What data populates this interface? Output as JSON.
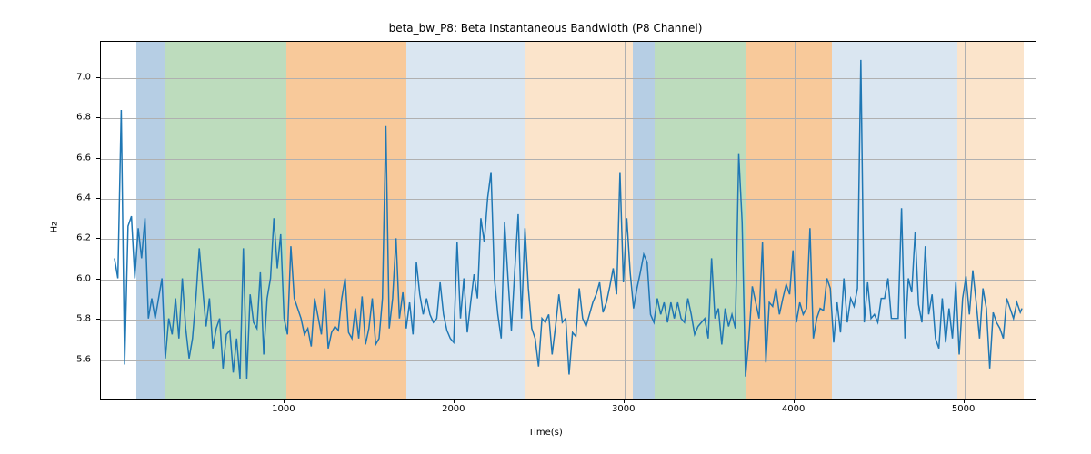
{
  "chart_data": {
    "type": "line",
    "title": "beta_bw_P8: Beta Instantaneous Bandwidth (P8 Channel)",
    "xlabel": "Time(s)",
    "ylabel": "Hz",
    "xlim": [
      -80,
      5430
    ],
    "ylim": [
      5.4,
      7.18
    ],
    "xticks": [
      1000,
      2000,
      3000,
      4000,
      5000
    ],
    "yticks": [
      5.6,
      5.8,
      6.0,
      6.2,
      6.4,
      6.6,
      6.8,
      7.0
    ],
    "bands": [
      {
        "x0": 130,
        "x1": 300,
        "color": "#b6cee4"
      },
      {
        "x0": 300,
        "x1": 1010,
        "color": "#bddcbd"
      },
      {
        "x0": 1010,
        "x1": 1720,
        "color": "#f8c99a"
      },
      {
        "x0": 1720,
        "x1": 2420,
        "color": "#dae6f1"
      },
      {
        "x0": 2420,
        "x1": 3050,
        "color": "#fbe4cb"
      },
      {
        "x0": 3050,
        "x1": 3180,
        "color": "#b6cee4"
      },
      {
        "x0": 3180,
        "x1": 3720,
        "color": "#bddcbd"
      },
      {
        "x0": 3720,
        "x1": 4220,
        "color": "#f8c99a"
      },
      {
        "x0": 4220,
        "x1": 4960,
        "color": "#dae6f1"
      },
      {
        "x0": 4960,
        "x1": 5350,
        "color": "#fbe4cb"
      }
    ],
    "x": [
      0,
      20,
      40,
      60,
      80,
      100,
      120,
      140,
      160,
      180,
      200,
      220,
      240,
      260,
      280,
      300,
      320,
      340,
      360,
      380,
      400,
      420,
      440,
      460,
      480,
      500,
      520,
      540,
      560,
      580,
      600,
      620,
      640,
      660,
      680,
      700,
      720,
      740,
      760,
      780,
      800,
      820,
      840,
      860,
      880,
      900,
      920,
      940,
      960,
      980,
      1000,
      1020,
      1040,
      1060,
      1080,
      1100,
      1120,
      1140,
      1160,
      1180,
      1200,
      1220,
      1240,
      1260,
      1280,
      1300,
      1320,
      1340,
      1360,
      1380,
      1400,
      1420,
      1440,
      1460,
      1480,
      1500,
      1520,
      1540,
      1560,
      1580,
      1600,
      1620,
      1640,
      1660,
      1680,
      1700,
      1720,
      1740,
      1760,
      1780,
      1800,
      1820,
      1840,
      1860,
      1880,
      1900,
      1920,
      1940,
      1960,
      1980,
      2000,
      2020,
      2040,
      2060,
      2080,
      2100,
      2120,
      2140,
      2160,
      2180,
      2200,
      2220,
      2240,
      2260,
      2280,
      2300,
      2320,
      2340,
      2360,
      2380,
      2400,
      2420,
      2440,
      2460,
      2480,
      2500,
      2520,
      2540,
      2560,
      2580,
      2600,
      2620,
      2640,
      2660,
      2680,
      2700,
      2720,
      2740,
      2760,
      2780,
      2800,
      2820,
      2840,
      2860,
      2880,
      2900,
      2920,
      2940,
      2960,
      2980,
      3000,
      3020,
      3040,
      3060,
      3080,
      3100,
      3120,
      3140,
      3160,
      3180,
      3200,
      3220,
      3240,
      3260,
      3280,
      3300,
      3320,
      3340,
      3360,
      3380,
      3400,
      3420,
      3440,
      3460,
      3480,
      3500,
      3520,
      3540,
      3560,
      3580,
      3600,
      3620,
      3640,
      3660,
      3680,
      3700,
      3720,
      3740,
      3760,
      3780,
      3800,
      3820,
      3840,
      3860,
      3880,
      3900,
      3920,
      3940,
      3960,
      3980,
      4000,
      4020,
      4040,
      4060,
      4080,
      4100,
      4120,
      4140,
      4160,
      4180,
      4200,
      4220,
      4240,
      4260,
      4280,
      4300,
      4320,
      4340,
      4360,
      4380,
      4400,
      4420,
      4440,
      4460,
      4480,
      4500,
      4520,
      4540,
      4560,
      4580,
      4600,
      4620,
      4640,
      4660,
      4680,
      4700,
      4720,
      4740,
      4760,
      4780,
      4800,
      4820,
      4840,
      4860,
      4880,
      4900,
      4920,
      4940,
      4960,
      4980,
      5000,
      5020,
      5040,
      5060,
      5080,
      5100,
      5120,
      5140,
      5160,
      5180,
      5200,
      5220,
      5240,
      5260,
      5280,
      5300,
      5320,
      5340,
      5350
    ],
    "y": [
      6.1,
      6.0,
      6.84,
      5.57,
      6.26,
      6.31,
      6.0,
      6.25,
      6.1,
      6.3,
      5.8,
      5.9,
      5.8,
      5.9,
      6.0,
      5.6,
      5.8,
      5.72,
      5.9,
      5.7,
      6.0,
      5.75,
      5.6,
      5.7,
      5.9,
      6.15,
      5.95,
      5.76,
      5.9,
      5.65,
      5.75,
      5.8,
      5.55,
      5.72,
      5.74,
      5.53,
      5.7,
      5.5,
      6.15,
      5.5,
      5.92,
      5.78,
      5.75,
      6.03,
      5.62,
      5.9,
      6.0,
      6.3,
      6.05,
      6.22,
      5.8,
      5.72,
      6.16,
      5.9,
      5.85,
      5.8,
      5.72,
      5.75,
      5.66,
      5.9,
      5.81,
      5.72,
      5.95,
      5.65,
      5.73,
      5.76,
      5.74,
      5.9,
      6.0,
      5.73,
      5.7,
      5.85,
      5.7,
      5.91,
      5.67,
      5.75,
      5.9,
      5.67,
      5.7,
      5.9,
      6.76,
      5.75,
      5.9,
      6.2,
      5.8,
      5.93,
      5.75,
      5.88,
      5.72,
      6.08,
      5.92,
      5.82,
      5.9,
      5.82,
      5.78,
      5.8,
      5.98,
      5.82,
      5.74,
      5.7,
      5.68,
      6.18,
      5.8,
      6.0,
      5.73,
      5.88,
      6.02,
      5.9,
      6.3,
      6.18,
      6.4,
      6.53,
      6.0,
      5.82,
      5.7,
      6.28,
      6.0,
      5.74,
      6.04,
      6.32,
      5.8,
      6.25,
      5.95,
      5.75,
      5.7,
      5.56,
      5.8,
      5.78,
      5.82,
      5.62,
      5.76,
      5.92,
      5.78,
      5.8,
      5.52,
      5.73,
      5.71,
      5.95,
      5.8,
      5.76,
      5.82,
      5.88,
      5.92,
      5.98,
      5.83,
      5.88,
      5.96,
      6.05,
      5.92,
      6.53,
      5.98,
      6.3,
      6.03,
      5.85,
      5.95,
      6.03,
      6.12,
      6.08,
      5.82,
      5.78,
      5.9,
      5.82,
      5.88,
      5.78,
      5.88,
      5.8,
      5.88,
      5.8,
      5.78,
      5.9,
      5.82,
      5.72,
      5.76,
      5.78,
      5.8,
      5.7,
      6.1,
      5.8,
      5.85,
      5.67,
      5.85,
      5.76,
      5.82,
      5.75,
      6.62,
      6.28,
      5.51,
      5.7,
      5.96,
      5.88,
      5.8,
      6.18,
      5.58,
      5.88,
      5.86,
      5.95,
      5.82,
      5.9,
      5.97,
      5.92,
      6.14,
      5.78,
      5.88,
      5.82,
      5.85,
      6.25,
      5.7,
      5.8,
      5.85,
      5.84,
      6.0,
      5.95,
      5.68,
      5.88,
      5.73,
      6.0,
      5.78,
      5.9,
      5.86,
      5.95,
      7.09,
      5.78,
      5.98,
      5.8,
      5.82,
      5.78,
      5.9,
      5.9,
      6.0,
      5.8,
      5.8,
      5.8,
      6.35,
      5.7,
      6.0,
      5.93,
      6.23,
      5.87,
      5.78,
      6.16,
      5.82,
      5.92,
      5.7,
      5.65,
      5.9,
      5.68,
      5.85,
      5.7,
      5.98,
      5.62,
      5.9,
      6.01,
      5.82,
      6.04,
      5.88,
      5.7,
      5.95,
      5.85,
      5.55,
      5.83,
      5.78,
      5.75,
      5.7,
      5.9,
      5.85,
      5.8,
      5.88,
      5.83,
      5.85
    ]
  }
}
